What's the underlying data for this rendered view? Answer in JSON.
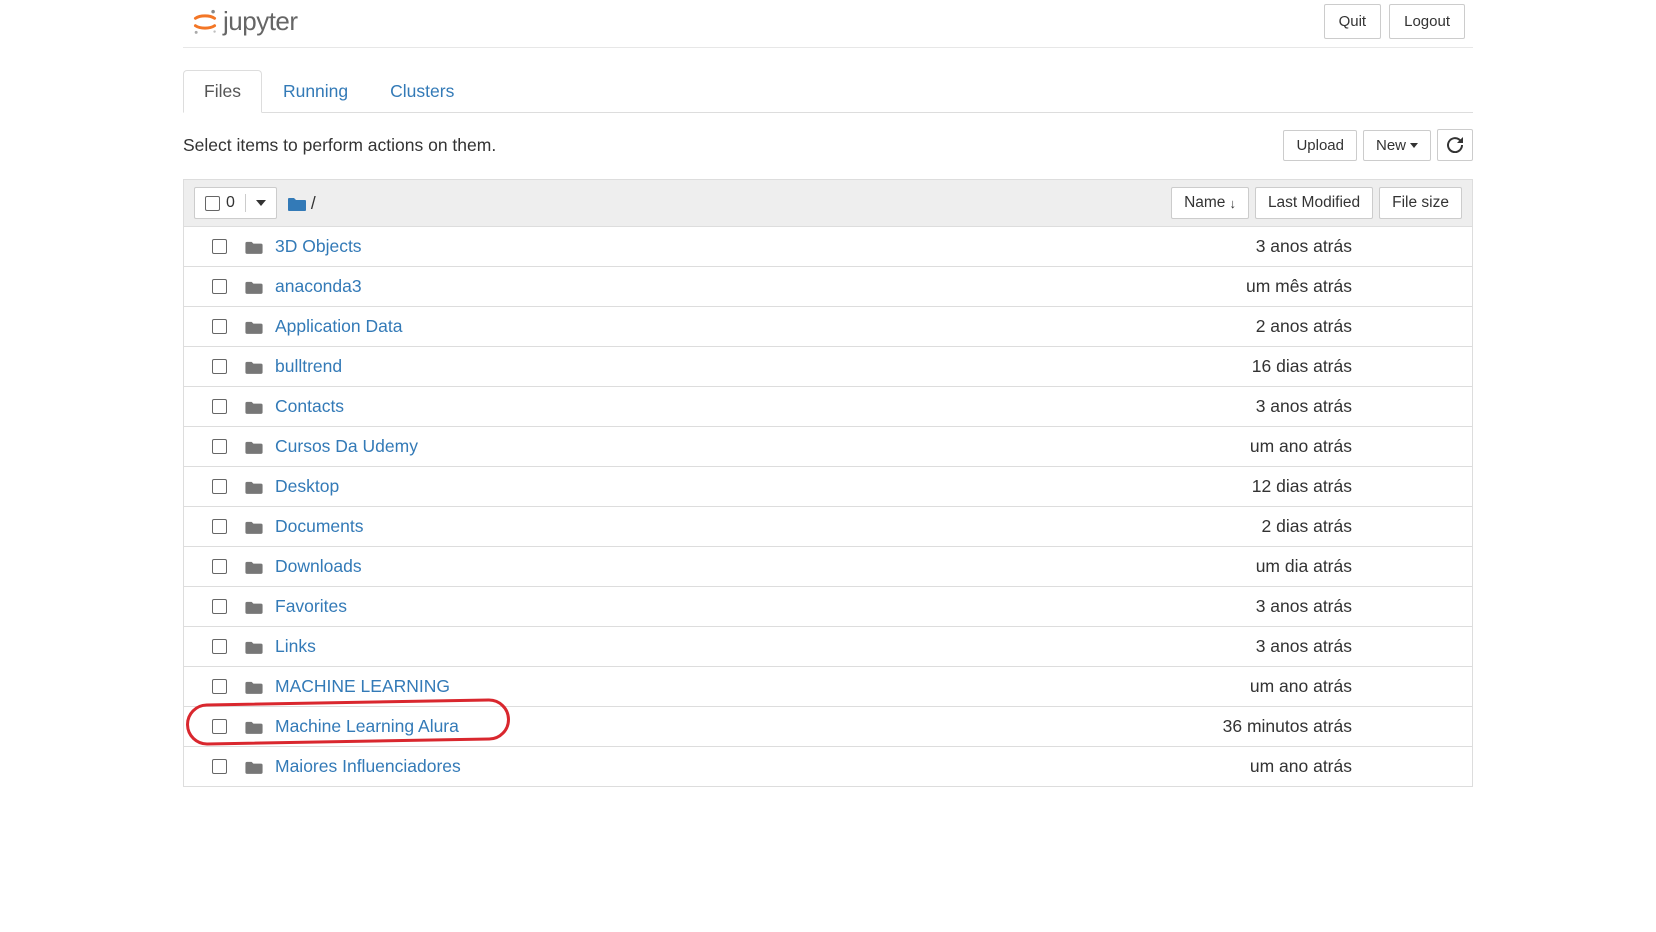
{
  "header": {
    "logo_text": "jupyter",
    "quit_label": "Quit",
    "logout_label": "Logout"
  },
  "tabs": {
    "files": "Files",
    "running": "Running",
    "clusters": "Clusters"
  },
  "toolbar": {
    "hint": "Select items to perform actions on them.",
    "upload_label": "Upload",
    "new_label": "New"
  },
  "list_header": {
    "selected_count": "0",
    "breadcrumb_sep": "/",
    "name_label": "Name",
    "last_modified_label": "Last Modified",
    "file_size_label": "File size"
  },
  "files": [
    {
      "name": "3D Objects",
      "modified": "3 anos atrás"
    },
    {
      "name": "anaconda3",
      "modified": "um mês atrás"
    },
    {
      "name": "Application Data",
      "modified": "2 anos atrás"
    },
    {
      "name": "bulltrend",
      "modified": "16 dias atrás"
    },
    {
      "name": "Contacts",
      "modified": "3 anos atrás"
    },
    {
      "name": "Cursos Da Udemy",
      "modified": "um ano atrás"
    },
    {
      "name": "Desktop",
      "modified": "12 dias atrás"
    },
    {
      "name": "Documents",
      "modified": "2 dias atrás"
    },
    {
      "name": "Downloads",
      "modified": "um dia atrás"
    },
    {
      "name": "Favorites",
      "modified": "3 anos atrás"
    },
    {
      "name": "Links",
      "modified": "3 anos atrás"
    },
    {
      "name": "MACHINE LEARNING",
      "modified": "um ano atrás"
    },
    {
      "name": "Machine Learning Alura",
      "modified": "36 minutos atrás",
      "annotated": true
    },
    {
      "name": "Maiores Influenciadores",
      "modified": "um ano atrás"
    }
  ]
}
